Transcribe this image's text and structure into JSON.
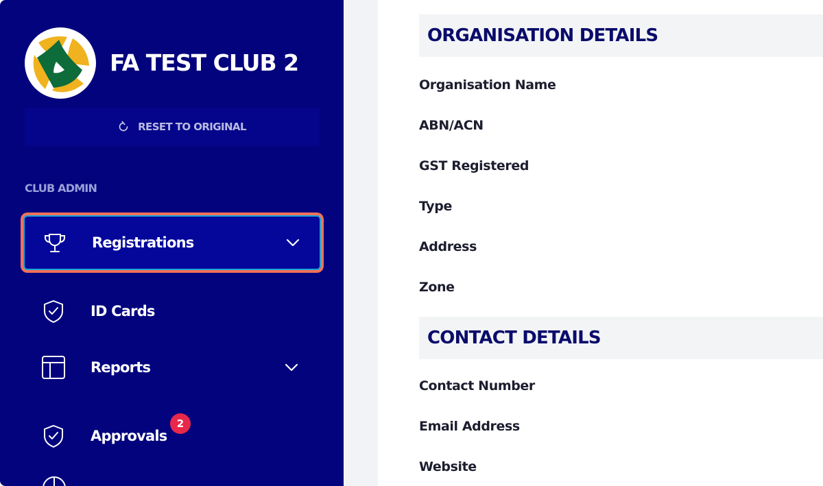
{
  "sidebar": {
    "club_name": "FA TEST CLUB 2",
    "reset_label": "RESET TO ORIGINAL",
    "section_label": "CLUB ADMIN",
    "items": [
      {
        "label": "Registrations",
        "icon": "trophy-icon",
        "active": true,
        "expandable": true
      },
      {
        "label": "ID Cards",
        "icon": "shield-check-icon",
        "active": false,
        "expandable": false
      },
      {
        "label": "Reports",
        "icon": "table-layout-icon",
        "active": false,
        "expandable": true
      },
      {
        "label": "Approvals",
        "icon": "shield-check-icon",
        "active": false,
        "expandable": false,
        "badge": "2"
      }
    ]
  },
  "main": {
    "organisation": {
      "heading": "ORGANISATION DETAILS",
      "fields": [
        "Organisation Name",
        "ABN/ACN",
        "GST Registered",
        "Type",
        "Address",
        "Zone"
      ]
    },
    "contact": {
      "heading": "CONTACT DETAILS",
      "fields": [
        "Contact Number",
        "Email Address",
        "Website"
      ]
    }
  },
  "colors": {
    "sidebar_bg": "#02037d",
    "active_item_bg": "#04079a",
    "highlight_outline": "#f0705b",
    "badge": "#e8284a",
    "heading_text": "#0a0c6b"
  }
}
